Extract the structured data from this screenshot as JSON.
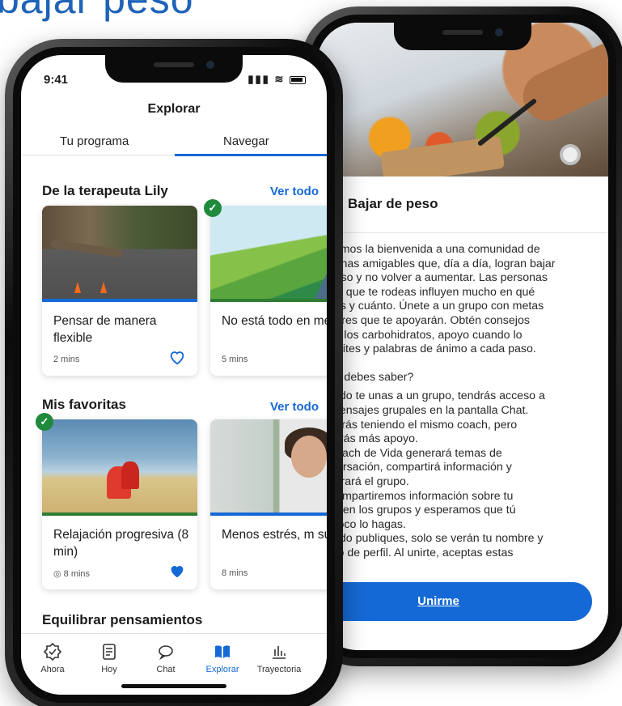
{
  "page": {
    "heading": "bajar peso"
  },
  "back_phone": {
    "title": "Bajar de peso",
    "body_lines": [
      "Te damos la bienvenida a una comunidad de",
      "personas amigables que, día a día, logran bajar",
      "de peso y no volver a aumentar. Las personas",
      "de las que te rodeas influyen mucho en qué",
      "comes y cuánto. Únete a un grupo con metas",
      "similares que te apoyarán. Obtén consejos",
      "sobre los carbohidratos, apoyo cuando lo",
      "necesites y palabras de ánimo a cada paso."
    ],
    "subheading": "¿Qué debes saber?",
    "list_lines": [
      "Cuando te unas a un grupo, tendrás acceso a",
      "los mensajes grupales en la pantalla Chat.",
      "Seguirás teniendo el mismo coach, pero",
      "recibirás más apoyo.",
      "Un coach de Vida generará temas de",
      "conversación, compartirá información y",
      "moderará el grupo.",
      "No compartiremos información sobre tu",
      "salud en los grupos y esperamos que tú",
      "tampoco lo hagas.",
      "Cuando publiques, solo se verán tu nombre y",
      "tu foto de perfil. Al unirte, aceptas estas"
    ],
    "join_button": "Unirme"
  },
  "front_phone": {
    "status_time": "9:41",
    "nav_title": "Explorar",
    "tabs": [
      "Tu programa",
      "Navegar"
    ],
    "section1": {
      "title": "De la terapeuta Lily",
      "see_all": "Ver todo",
      "cards": [
        {
          "title": "Pensar de manera flexible",
          "meta": "2 mins",
          "completed": false,
          "favorite": false
        },
        {
          "title": "No está todo en mente",
          "meta": "5 mins",
          "completed": true,
          "favorite": false
        }
      ]
    },
    "section2": {
      "title": "Mis favoritas",
      "see_all": "Ver todo",
      "cards": [
        {
          "title": "Relajación progresiva (8 min)",
          "meta": "8 mins",
          "completed": true,
          "favorite": true
        },
        {
          "title": "Menos estrés, m sueño",
          "meta": "8 mins",
          "completed": false,
          "favorite": false
        }
      ]
    },
    "section3": {
      "title": "Equilibrar pensamientos"
    },
    "bottom_nav": [
      {
        "label": "Ahora",
        "icon": "check-badge-icon",
        "active": false
      },
      {
        "label": "Hoy",
        "icon": "list-icon",
        "active": false
      },
      {
        "label": "Chat",
        "icon": "chat-bubble-icon",
        "active": false
      },
      {
        "label": "Explorar",
        "icon": "book-icon",
        "active": true
      },
      {
        "label": "Trayectoria",
        "icon": "bar-chart-icon",
        "active": false
      }
    ],
    "colors": {
      "accent": "#1569d6",
      "complete": "#1f8a3b",
      "favorite": "#1569d6"
    }
  }
}
